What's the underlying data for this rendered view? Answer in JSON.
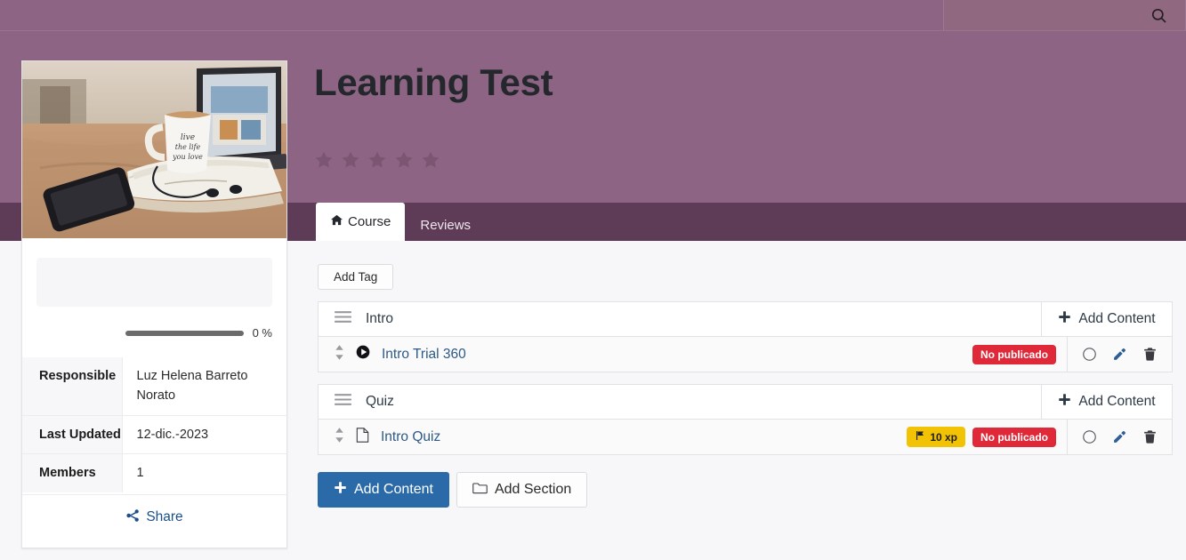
{
  "topbar": {
    "search_placeholder": "",
    "search_value": "",
    "search_icon": "search-icon"
  },
  "sidebar": {
    "thumbnail_alt": "desk-with-mug-phone-laptop",
    "progress": {
      "percent_label": "0 %",
      "value": 0
    },
    "info": [
      {
        "label": "Responsible",
        "value": "Luz Helena Barreto Norato"
      },
      {
        "label": "Last Updated",
        "value": "12-dic.-2023"
      },
      {
        "label": "Members",
        "value": "1"
      }
    ],
    "share": {
      "label": "Share",
      "icon": "share-nodes-icon"
    }
  },
  "course": {
    "title": "Learning Test",
    "rating": {
      "stars_total": 5,
      "stars_filled": 0
    }
  },
  "tabs": [
    {
      "label": "Course",
      "icon": "home-icon",
      "active": true
    },
    {
      "label": "Reviews",
      "icon": "",
      "active": false
    }
  ],
  "main": {
    "add_tag_label": "Add Tag",
    "sections": [
      {
        "name": "Intro",
        "drag_icon": "hamburger-icon",
        "add_content_label": "Add Content",
        "rows": [
          {
            "title": "Intro Trial 360",
            "type_icon": "play-circle-icon",
            "drag_icon": "sort-updown-icon",
            "badges": [
              {
                "kind": "unpublished",
                "label": "No publicado"
              }
            ],
            "actions": [
              "circle-toggle-icon",
              "pencil-icon",
              "trash-icon"
            ]
          }
        ]
      },
      {
        "name": "Quiz",
        "drag_icon": "hamburger-icon",
        "add_content_label": "Add Content",
        "rows": [
          {
            "title": "Intro Quiz",
            "type_icon": "file-icon",
            "drag_icon": "sort-updown-icon",
            "badges": [
              {
                "kind": "xp",
                "label": "10 xp",
                "icon": "flag-icon"
              },
              {
                "kind": "unpublished",
                "label": "No publicado"
              }
            ],
            "actions": [
              "circle-toggle-icon",
              "pencil-icon",
              "trash-icon"
            ]
          }
        ]
      }
    ],
    "footer_buttons": [
      {
        "label": "Add Content",
        "icon": "plus-icon",
        "style": "primary"
      },
      {
        "label": "Add Section",
        "icon": "folder-icon",
        "style": "default"
      }
    ]
  },
  "colors": {
    "header_purple": "#8d6484",
    "tabstrip_purple": "#5e3c57",
    "primary_blue": "#2a6aa8",
    "badge_red": "#e02938",
    "badge_yellow": "#f2c204",
    "link_blue": "#2d5986"
  }
}
